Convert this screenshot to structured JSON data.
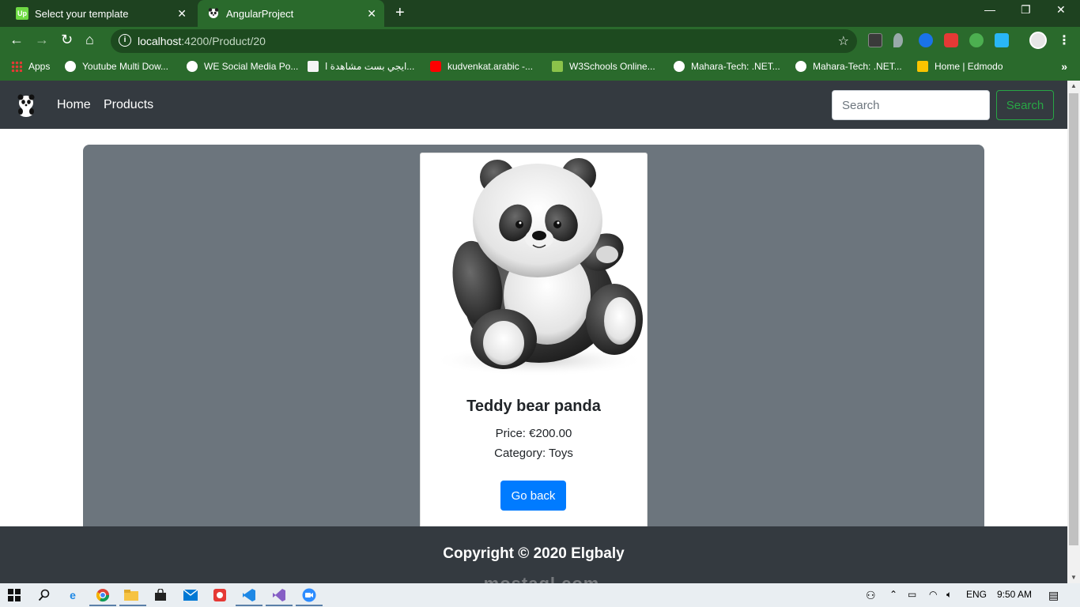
{
  "browser": {
    "tabs": [
      {
        "title": "Select your template",
        "favicon": "upwork-icon"
      },
      {
        "title": "AngularProject",
        "favicon": "panda-icon"
      }
    ],
    "url_host": "localhost",
    "url_path": ":4200/Product/20",
    "bookmarks": [
      {
        "label": "Apps",
        "icon": "apps-grid-icon"
      },
      {
        "label": "Youtube Multi Dow...",
        "icon": "globe-icon"
      },
      {
        "label": "WE Social Media Po...",
        "icon": "globe-icon"
      },
      {
        "label": "ايجي بست مشاهدة ا...",
        "icon": "egybest-icon"
      },
      {
        "label": "kudvenkat.arabic -...",
        "icon": "youtube-icon"
      },
      {
        "label": "W3Schools Online...",
        "icon": "w3schools-icon"
      },
      {
        "label": "Mahara-Tech: .NET...",
        "icon": "mahara-icon"
      },
      {
        "label": "Mahara-Tech: .NET...",
        "icon": "mahara-icon"
      },
      {
        "label": "Home | Edmodo",
        "icon": "edmodo-icon"
      }
    ]
  },
  "navbar": {
    "links": [
      "Home",
      "Products"
    ],
    "search_placeholder": "Search",
    "search_button": "Search"
  },
  "product": {
    "title": "Teddy bear panda",
    "price": "Price: €200.00",
    "category": "Category: Toys",
    "back_label": "Go back"
  },
  "footer": {
    "text": "Copyright © 2020 Elgbaly",
    "watermark": "mostaql.com"
  },
  "taskbar": {
    "language": "ENG",
    "time": "9:50 AM"
  },
  "colors": {
    "chrome_dark": "#1e4220",
    "chrome": "#2a6a2c",
    "navbar": "#343a40",
    "jumbotron": "#6c757d",
    "primary": "#007bff",
    "success": "#28a745"
  }
}
